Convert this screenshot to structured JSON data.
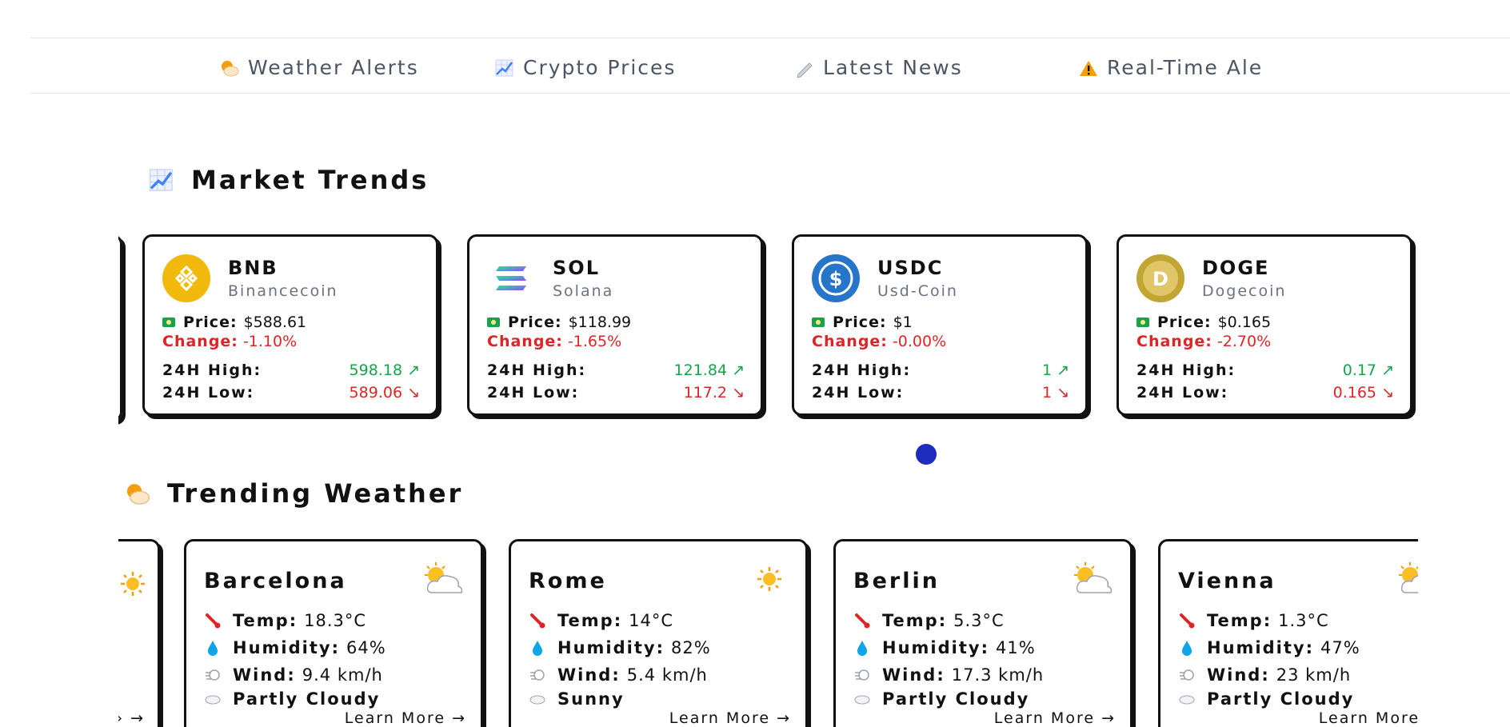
{
  "nav": {
    "items": [
      {
        "label": "Weather Alerts",
        "icon": "sun-behind-cloud-icon"
      },
      {
        "label": "Crypto Prices",
        "icon": "chart-increasing-icon"
      },
      {
        "label": "Latest News",
        "icon": "pencil-icon"
      },
      {
        "label": "Real-Time Ale",
        "icon": "warning-icon"
      }
    ]
  },
  "market": {
    "title": "Market Trends",
    "price_label": "Price:",
    "change_label": "Change:",
    "high_label": "24H High:",
    "low_label": "24H Low:",
    "coins": [
      {
        "symbol": "BNB",
        "name": "Binancecoin",
        "price": "$588.61",
        "change": "-1.10%",
        "high": "598.18",
        "low": "589.06",
        "logo_color": "#f0b90b"
      },
      {
        "symbol": "SOL",
        "name": "Solana",
        "price": "$118.99",
        "change": "-1.65%",
        "high": "121.84",
        "low": "117.2",
        "logo_color": "#9945ff"
      },
      {
        "symbol": "USDC",
        "name": "Usd-Coin",
        "price": "$1",
        "change": "-0.00%",
        "high": "1",
        "low": "1",
        "logo_color": "#2775ca"
      },
      {
        "symbol": "DOGE",
        "name": "Dogecoin",
        "price": "$0.165",
        "change": "-2.70%",
        "high": "0.17",
        "low": "0.165",
        "logo_color": "#c2a633"
      }
    ]
  },
  "weather": {
    "title": "Trending Weather",
    "temp_label": "Temp:",
    "humidity_label": "Humidity:",
    "wind_label": "Wind:",
    "learn_more": "Learn More →",
    "partial_learn_more": "› →",
    "cities": [
      {
        "city": "Barcelona",
        "temp": "18.3°C",
        "humidity": "64%",
        "wind": "9.4 km/h",
        "condition": "Partly Cloudy",
        "icon": "sun-behind-cloud-icon"
      },
      {
        "city": "Rome",
        "temp": "14°C",
        "humidity": "82%",
        "wind": "5.4 km/h",
        "condition": "Sunny",
        "icon": "sun-icon"
      },
      {
        "city": "Berlin",
        "temp": "5.3°C",
        "humidity": "41%",
        "wind": "17.3 km/h",
        "condition": "Partly Cloudy",
        "icon": "sun-behind-cloud-icon"
      },
      {
        "city": "Vienna",
        "temp": "1.3°C",
        "humidity": "47%",
        "wind": "23 km/h",
        "condition": "Partly Cloudy",
        "icon": "sun-behind-cloud-icon"
      }
    ]
  },
  "colors": {
    "accent_dot": "#1e2bbf",
    "up": "#16a34a",
    "down": "#dc2626"
  }
}
